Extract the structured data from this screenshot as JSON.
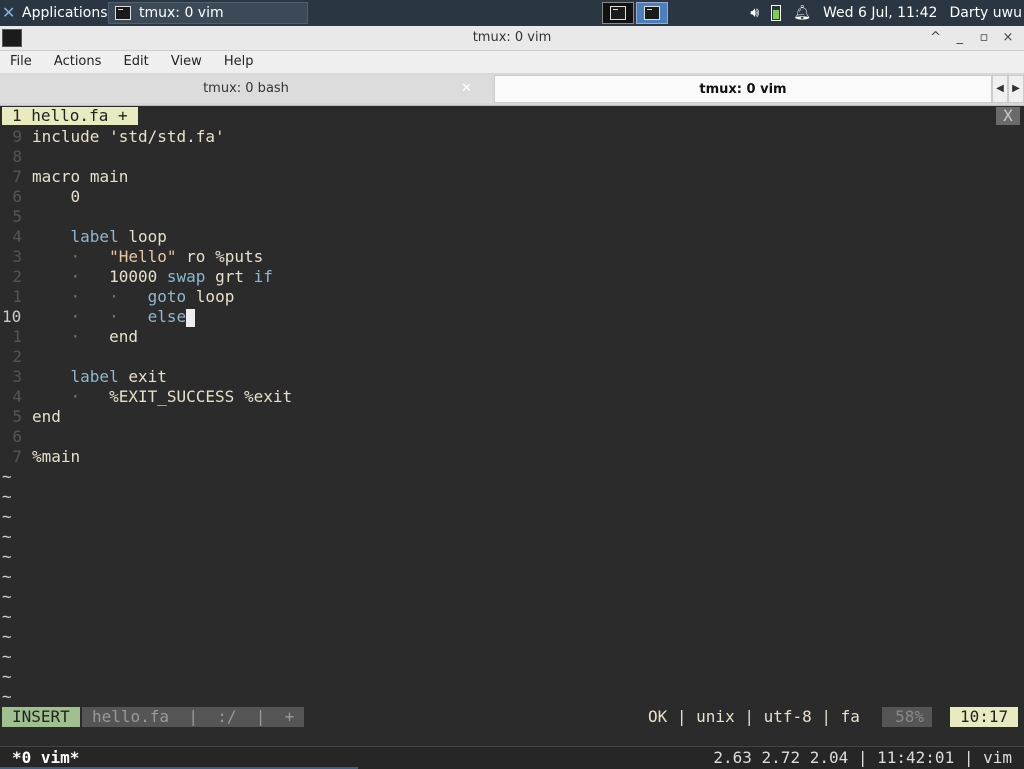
{
  "panel": {
    "apps_label": "Applications",
    "task_label": "tmux: 0 vim",
    "clock": "Wed  6 Jul, 11:42",
    "user": "Darty uwu",
    "volume_icon": "volume-icon",
    "battery_icon": "battery-icon",
    "bell_icon": "bell-icon"
  },
  "window": {
    "title": "tmux: 0 vim",
    "controls": [
      "^",
      "_",
      "▫",
      "×"
    ]
  },
  "menu": [
    "File",
    "Actions",
    "Edit",
    "View",
    "Help"
  ],
  "tabs": [
    {
      "label": "tmux: 0 bash",
      "active": false
    },
    {
      "label": "tmux: 0 vim",
      "active": true
    }
  ],
  "vim": {
    "buffer_tab": "1  hello.fa  +",
    "buffer_close": "X",
    "lines": [
      {
        "num": "9",
        "text": "include 'std/std.fa'"
      },
      {
        "num": "8",
        "text": ""
      },
      {
        "num": "7",
        "text": "macro main"
      },
      {
        "num": "6",
        "text": "    0"
      },
      {
        "num": "5",
        "text": ""
      },
      {
        "num": "4",
        "text": "    label loop"
      },
      {
        "num": "3",
        "text": "    ·   \"Hello\" ro %puts"
      },
      {
        "num": "2",
        "text": "    ·   10000 swap grt if"
      },
      {
        "num": "1",
        "text": "    ·   ·   goto loop"
      },
      {
        "num": "10",
        "text": "    ·   ·   else",
        "current": true
      },
      {
        "num": "1",
        "text": "    ·   end"
      },
      {
        "num": "2",
        "text": ""
      },
      {
        "num": "3",
        "text": "    label exit"
      },
      {
        "num": "4",
        "text": "    ·   %EXIT_SUCCESS %exit"
      },
      {
        "num": "5",
        "text": "end"
      },
      {
        "num": "6",
        "text": ""
      },
      {
        "num": "7",
        "text": "%main"
      }
    ],
    "tilde_count": 12,
    "tilde": "~",
    "status": {
      "mode": "INSERT",
      "file": "hello.fa  |  :/  |  +",
      "right": "OK | unix | utf-8 | fa",
      "percent": "58%",
      "position": "10:17"
    }
  },
  "tmux": {
    "window": "*0 vim*",
    "right": "2.63 2.72 2.04 | 11:42:01 | vim"
  }
}
